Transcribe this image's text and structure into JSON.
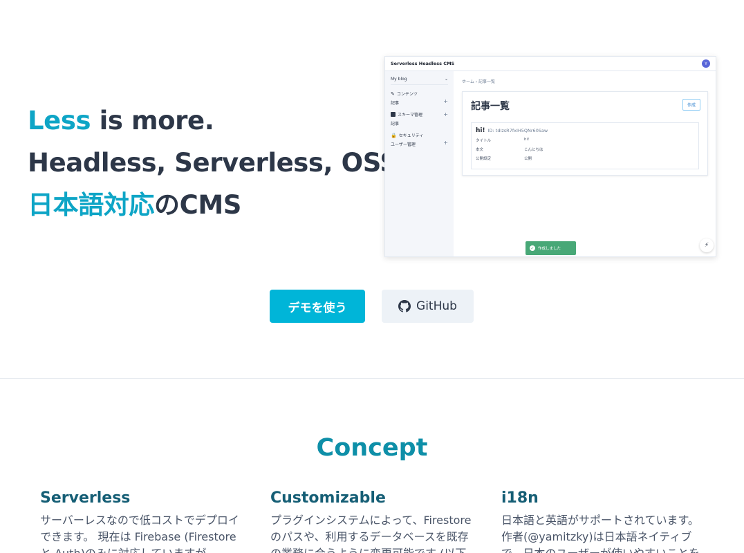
{
  "hero": {
    "line1_accent": "Less",
    "line1_rest": " is more.",
    "line2": "Headless, Serverless, OSS.",
    "line3_accent": "日本語対応",
    "line3_rest": "のCMS"
  },
  "preview": {
    "app_title": "Serverless Headless CMS",
    "avatar": "Y",
    "sidebar": {
      "project": "My blog",
      "groups": [
        {
          "label": "コンテンツ",
          "icon": "edit-icon",
          "sub": "記事"
        },
        {
          "label": "スキーマ管理",
          "icon": "table-icon",
          "sub": "記事"
        },
        {
          "label": "セキュリティ",
          "icon": "lock-icon",
          "sub": "ユーザー管理"
        }
      ]
    },
    "breadcrumb": "ホーム  ›  記事一覧",
    "page_title": "記事一覧",
    "create_label": "作成",
    "entry": {
      "title": "hi!",
      "id": "ID: tdIzsR7fxIH5QNr60Saw",
      "fields": [
        {
          "key": "タイトル",
          "value": "hi!"
        },
        {
          "key": "本文",
          "value": "こんにちは"
        },
        {
          "key": "公開設定",
          "value": "公開"
        }
      ]
    },
    "toast": "作成しました"
  },
  "cta": {
    "demo_label": "デモを使う",
    "github_label": "GitHub"
  },
  "concept": {
    "title": "Concept",
    "columns": [
      {
        "title": "Serverless",
        "body": "サーバーレスなので低コストでデプロイできます。 現在は Firebase (Firestore と Auth)のみに対応していますが、AWSなどにも対応予定です。"
      },
      {
        "title": "Customizable",
        "body": "プラグインシステムによって、Firestore のパスや、利用するデータベースを既存の業務に合うように変更可能です (以下略)"
      },
      {
        "title": "i18n",
        "body": "日本語と英語がサポートされています。 作者(@yamitzky)は日本語ネイティブで、日本のユーザーが使いやすいことを"
      }
    ]
  },
  "colors": {
    "accent": "#0ea5c6",
    "demo_button": "#00b5d8",
    "heading": "#155e75"
  }
}
